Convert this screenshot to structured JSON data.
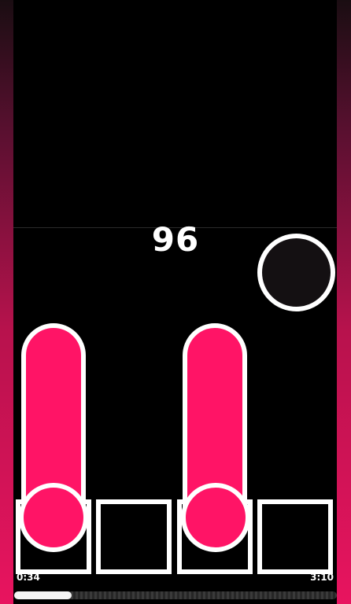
{
  "game": {
    "score": "96"
  },
  "playback": {
    "elapsed": "0:34",
    "total": "3:10",
    "progress_fraction": 0.179
  },
  "colors": {
    "note": "#ff1466",
    "outline": "#ffffff",
    "background": "#000000",
    "side_gradient_bottom": "#e8145f"
  },
  "lanes": [
    {
      "lane": 1,
      "has_hold_note": true
    },
    {
      "lane": 2,
      "has_hold_note": false
    },
    {
      "lane": 3,
      "has_hold_note": true
    },
    {
      "lane": 4,
      "has_hold_note": false
    }
  ]
}
